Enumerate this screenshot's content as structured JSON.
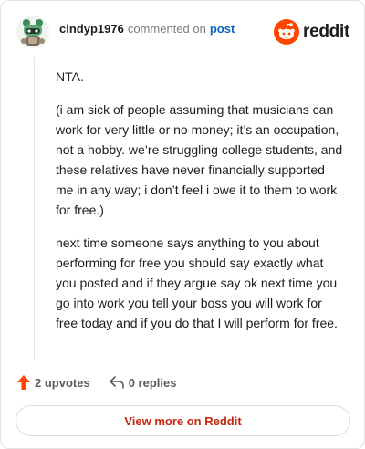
{
  "header": {
    "username": "cindyp1976",
    "commented_on": "commented on",
    "post_link": "post",
    "brand": "reddit"
  },
  "comment": {
    "paragraphs": [
      "NTA.",
      "(i am sick of people assuming that musicians can work for very little or no money; it’s an occupation, not a hobby. we’re struggling college students, and these relatives have never financially supported me in any way; i don’t feel i owe it to them to work for free.)",
      "next time someone says anything to you about performing for free you should say exactly what you posted and if they argue say ok next time you go into work you tell your boss you will work for free today and if you do that I will perform for free."
    ]
  },
  "actions": {
    "upvotes": "2 upvotes",
    "replies": "0 replies"
  },
  "footer": {
    "view_more": "View more on Reddit"
  },
  "colors": {
    "brand_orange": "#ff4500",
    "link_blue": "#0a66c2",
    "cta_red": "#c2280f"
  },
  "icons": [
    "avatar-icon",
    "reddit-logo-icon",
    "upvote-arrow-icon",
    "reply-arrow-icon"
  ]
}
